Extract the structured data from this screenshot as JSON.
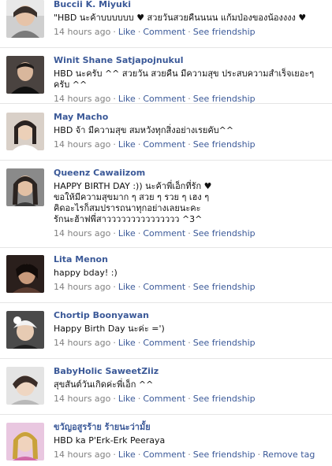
{
  "comments": [
    {
      "name": "Buccii K. Miyuki",
      "message": "\"HBD นะค้าบบบบบบ ♥ สวยวันสวยคืนนนน แก้มป่องของน้องงงง ♥",
      "time": "14 hours ago",
      "actions": [
        "Like",
        "Comment",
        "See friendship"
      ],
      "avatar_icon": "profile-photo"
    },
    {
      "name": "Winit Shane Satjapojnukul",
      "message": "HBD นะครับ ^^ สวยวัน สวยคืน มีความสุข ประสบความสำเร็จเยอะๆครับ ^^",
      "time": "14 hours ago",
      "actions": [
        "Like",
        "Comment",
        "See friendship"
      ],
      "avatar_icon": "profile-photo"
    },
    {
      "name": "May Macho",
      "message": "HBD จ้า มีความสุข สมหวังทุกสิ่งอย่างเรยคับ^^",
      "time": "14 hours ago",
      "actions": [
        "Like",
        "Comment",
        "See friendship"
      ],
      "avatar_icon": "profile-photo"
    },
    {
      "name": "Queenz Cawaiizom",
      "message": "HAPPY BIRTH DAY :)) นะค้าพี่เอ็กที่รัก ♥\nขอให้มีความสุขมาก ๆ สวย ๆ รวย ๆ เฮง ๆ\nคิดอะไรก็สมปรารถนาทุกอย่างเลยนะคะ\nรักนะฮ้าฟพี่สาววววววววววววววว ^3^",
      "time": "14 hours ago",
      "actions": [
        "Like",
        "Comment",
        "See friendship"
      ],
      "avatar_icon": "profile-photo"
    },
    {
      "name": "Lita Menon",
      "message": "happy bday! :)",
      "time": "14 hours ago",
      "actions": [
        "Like",
        "Comment",
        "See friendship"
      ],
      "avatar_icon": "profile-photo"
    },
    {
      "name": "Chortip Boonyawan",
      "message": "Happy Birth Day นะค่ะ =')",
      "time": "14 hours ago",
      "actions": [
        "Like",
        "Comment",
        "See friendship"
      ],
      "avatar_icon": "profile-photo"
    },
    {
      "name": "BabyHolic SaweetZiiz",
      "message": "สุขสันต์วันเกิดค่ะพี่เอ็ก ^^",
      "time": "14 hours ago",
      "actions": [
        "Like",
        "Comment",
        "See friendship"
      ],
      "avatar_icon": "profile-photo"
    },
    {
      "name": "ขวัญอสูรร้าย ร้ายนะว่ามั้ย",
      "message": "HBD ka P'Erk-Erk Peeraya",
      "time": "14 hours ago",
      "actions": [
        "Like",
        "Comment",
        "See friendship",
        "Remove tag"
      ],
      "avatar_icon": "profile-photo"
    }
  ],
  "colors": {
    "link": "#3b5998",
    "meta_text": "#808080",
    "body_text": "#111111",
    "divider": "#e5e5e5"
  }
}
